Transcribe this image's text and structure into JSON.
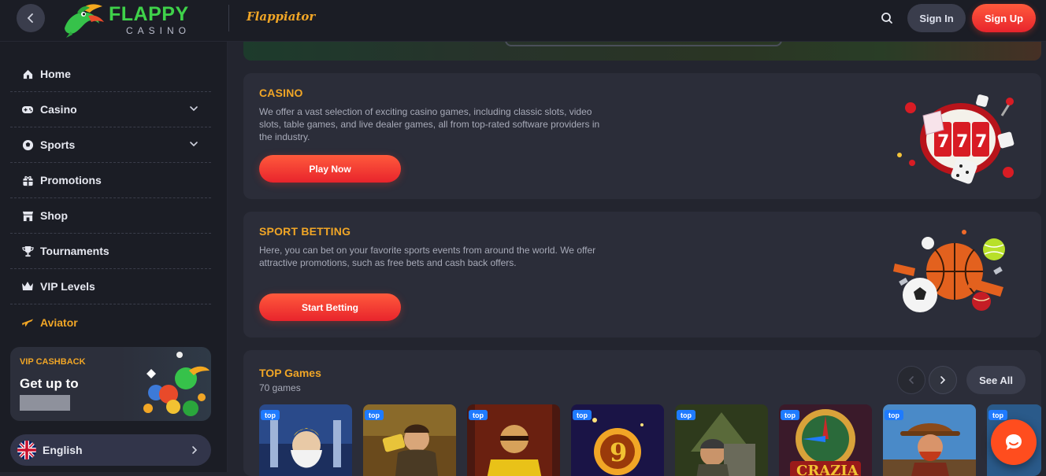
{
  "header": {
    "brand_main": "FLAPPY",
    "brand_sub": "CASINO",
    "partner_logo": "Flappiator",
    "signin_label": "Sign In",
    "signup_label": "Sign Up",
    "icons": [
      "chevron-left-icon",
      "search-icon"
    ]
  },
  "sidebar": {
    "items": [
      {
        "label": "Home",
        "icon": "home-icon"
      },
      {
        "label": "Casino",
        "icon": "gamepad-icon",
        "expandable": true
      },
      {
        "label": "Sports",
        "icon": "soccer-ball-icon",
        "expandable": true
      },
      {
        "label": "Promotions",
        "icon": "gift-icon"
      },
      {
        "label": "Shop",
        "icon": "shop-icon"
      },
      {
        "label": "Tournaments",
        "icon": "trophy-icon"
      },
      {
        "label": "VIP Levels",
        "icon": "crown-icon"
      },
      {
        "label": "Aviator",
        "icon": "airplane-icon"
      }
    ],
    "vip": {
      "title": "VIP CASHBACK",
      "text": "Get up to"
    },
    "language": {
      "label": "English",
      "flag": "uk-flag-icon"
    }
  },
  "sections": {
    "casino": {
      "title": "CASINO",
      "description": "We offer a vast selection of exciting casino games, including classic slots, video slots, table games, and live dealer games, all from top-rated software providers in the industry.",
      "cta": "Play Now"
    },
    "sport": {
      "title": "SPORT BETTING",
      "description": "Here, you can bet on your favorite sports events from around the world. We offer attractive promotions, such as free bets and cash back offers.",
      "cta": "Start Betting"
    },
    "top_games": {
      "title": "TOP Games",
      "count": "70 games",
      "see_all": "See All",
      "badge": "top",
      "tiles": [
        "game-tile-1",
        "game-tile-2",
        "game-tile-3",
        "game-tile-4",
        "game-tile-5",
        "game-tile-6",
        "game-tile-7",
        "game-tile-8"
      ],
      "tile_6_text": "CRAZIA"
    }
  },
  "colors": {
    "accent": "#f1a626",
    "primary_button": "#ff4a32",
    "background": "#23252f",
    "card": "#2b2d39",
    "sidebar": "#1b1d25"
  }
}
